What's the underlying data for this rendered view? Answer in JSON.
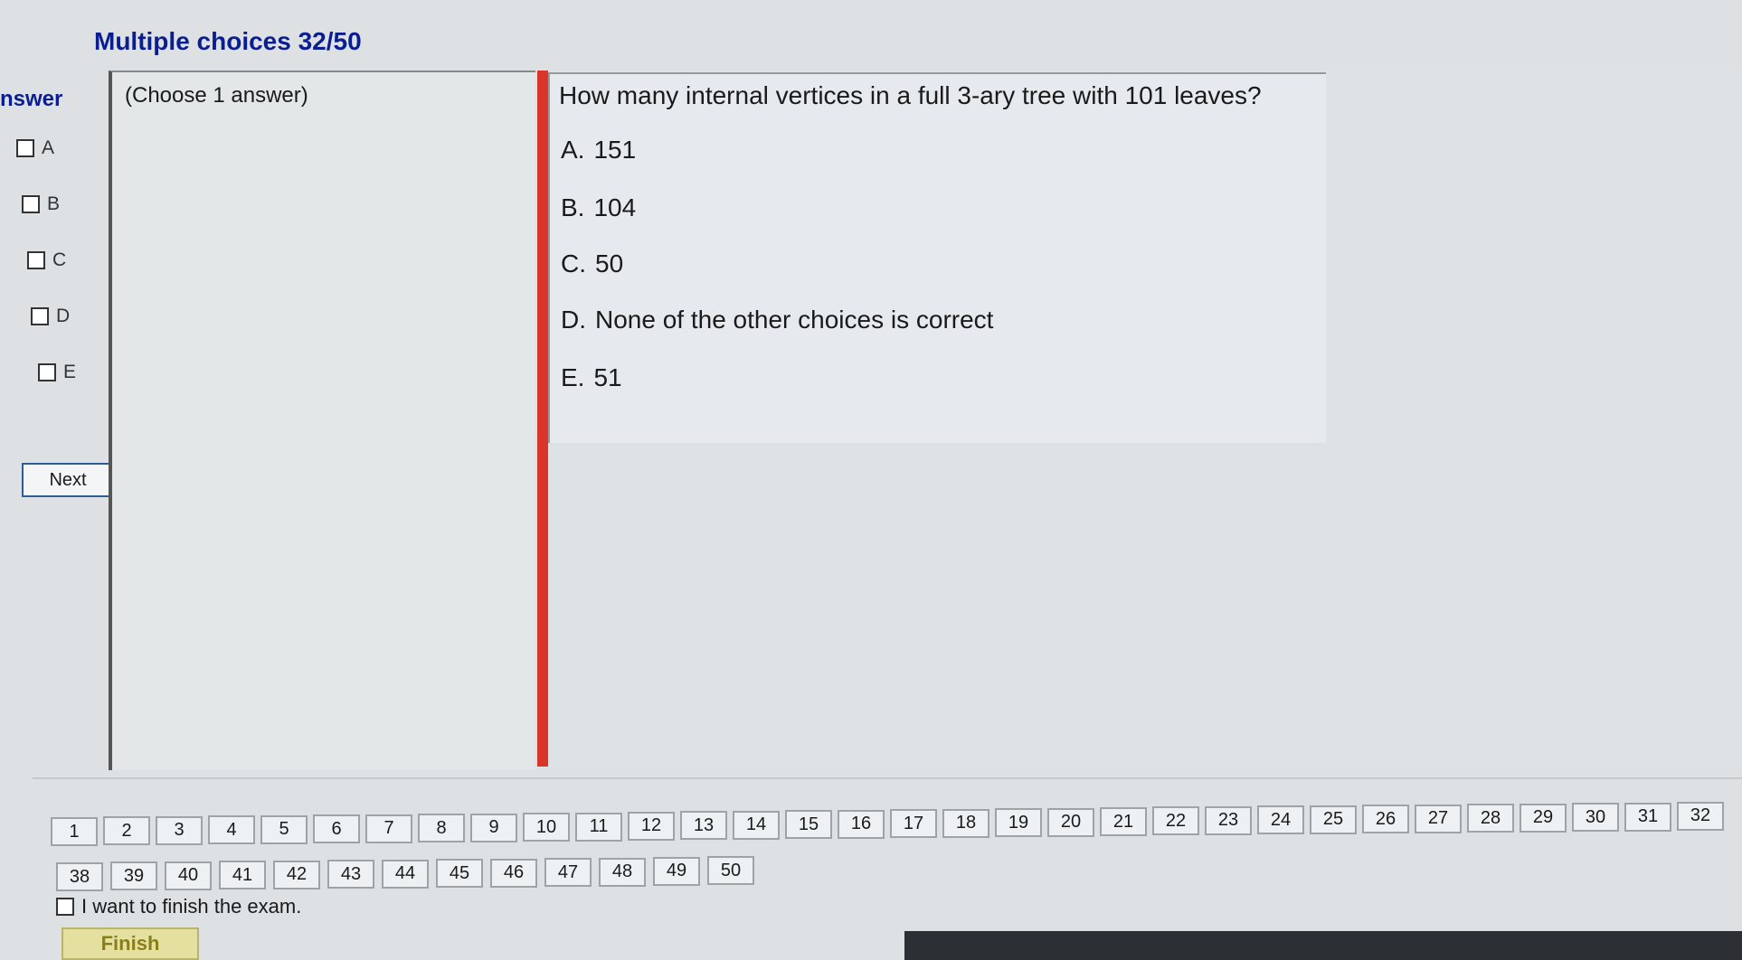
{
  "header": {
    "title": "Multiple choices 32/50"
  },
  "answer_panel": {
    "heading": "nswer",
    "choices": [
      "A",
      "B",
      "C",
      "D",
      "E"
    ],
    "next_label": "Next"
  },
  "choose_panel": {
    "label": "(Choose 1 answer)"
  },
  "question": {
    "text": "How many internal vertices in a full 3-ary tree with 101 leaves?",
    "options": [
      {
        "letter": "A.",
        "text": "151"
      },
      {
        "letter": "B.",
        "text": "104"
      },
      {
        "letter": "C.",
        "text": "50"
      },
      {
        "letter": "D.",
        "text": "None of the other choices is correct"
      },
      {
        "letter": "E.",
        "text": "51"
      }
    ]
  },
  "navigation": {
    "row1": [
      "1",
      "2",
      "3",
      "4",
      "5",
      "6",
      "7",
      "8",
      "9",
      "10",
      "11",
      "12",
      "13",
      "14",
      "15",
      "16",
      "17",
      "18",
      "19",
      "20",
      "21",
      "22",
      "23",
      "24",
      "25",
      "26",
      "27",
      "28",
      "29",
      "30",
      "31",
      "32"
    ],
    "row2": [
      "38",
      "39",
      "40",
      "41",
      "42",
      "43",
      "44",
      "45",
      "46",
      "47",
      "48",
      "49",
      "50"
    ]
  },
  "finish": {
    "checkbox_label": "I want to finish the exam.",
    "button_label": "Finish"
  }
}
